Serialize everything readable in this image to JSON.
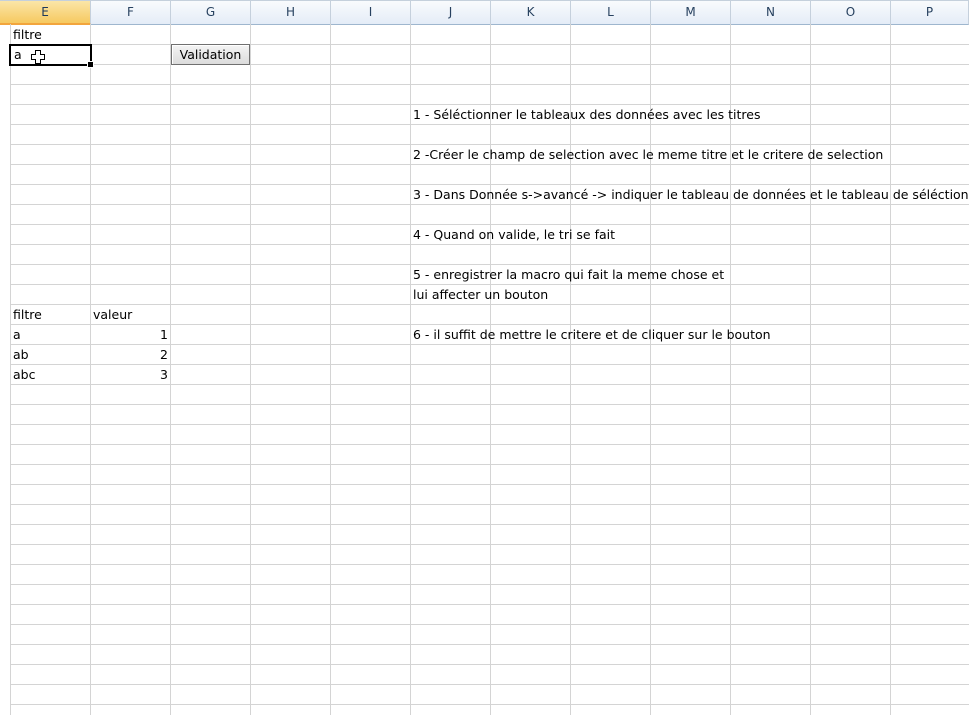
{
  "columns": [
    "E",
    "F",
    "G",
    "H",
    "I",
    "J",
    "K",
    "L",
    "M",
    "N",
    "O",
    "P"
  ],
  "active_column": "E",
  "criteria_range": {
    "header": "filtre",
    "value": "a"
  },
  "button": {
    "label": "Validation"
  },
  "instructions": [
    "1 - Séléctionner le tableaux des données avec les titres",
    "2 -Créer le champ de selection avec le meme titre et le critere de selection",
    "3 - Dans Donnée s->avancé -> indiquer le tableau de données et le tableau de séléction",
    "4 - Quand on valide, le tri se fait",
    "5 - enregistrer la macro qui fait la meme chose et",
    "lui affecter un bouton",
    "6 - il suffit de mettre le critere et de cliquer sur le bouton"
  ],
  "data_table": {
    "headers": [
      "filtre",
      "valeur"
    ],
    "rows": [
      [
        "a",
        "1"
      ],
      [
        "ab",
        "2"
      ],
      [
        "abc",
        "3"
      ]
    ]
  },
  "colors": {
    "grid_line": "#d4d4d4",
    "header_bg": "#e4ecf7",
    "active_header_bg": "#f6c960"
  }
}
